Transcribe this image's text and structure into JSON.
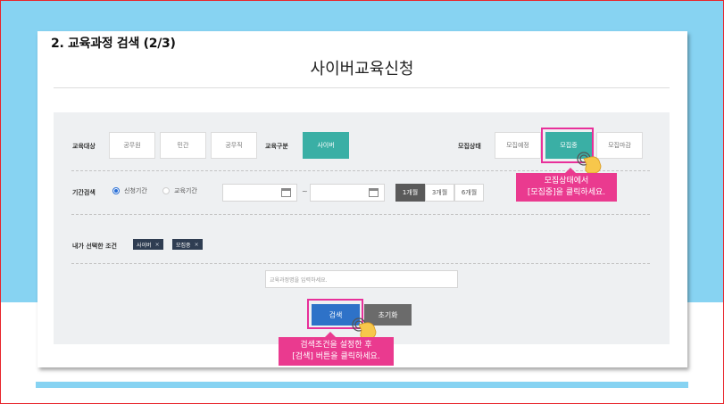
{
  "step_title": "2. 교육과정 검색 (2/3)",
  "page_title": "사이버교육신청",
  "filters": {
    "target_label": "교육대상",
    "target_options": [
      "공무원",
      "민간",
      "공무직"
    ],
    "type_label": "교육구분",
    "type_selected": "사이버",
    "status_label": "모집상태",
    "status_options": [
      "모집예정",
      "모집중",
      "모집마감"
    ],
    "status_selected": "모집중"
  },
  "period": {
    "label": "기간검색",
    "radio_apply": "신청기간",
    "radio_edu": "교육기간",
    "radio_selected": "신청기간",
    "tilde": "~",
    "ranges": [
      "1개월",
      "3개월",
      "6개월"
    ],
    "range_selected": "1개월"
  },
  "selected_conditions": {
    "label": "내가 선택한 조건",
    "chips": [
      "사이버",
      "모집중"
    ],
    "remove_glyph": "×"
  },
  "search": {
    "placeholder": "교육과정명을 입력하세요.",
    "search_label": "검색",
    "reset_label": "초기화"
  },
  "callouts": {
    "status_line1": "모집상태에서",
    "status_line2": "[모집중]을 클릭하세요.",
    "search_line1": "검색조건을 설정한 후",
    "search_line2": "[검색] 버튼을 클릭하세요."
  },
  "colors": {
    "teal": "#3aafa5",
    "blue": "#2e72c8",
    "pink": "#ea3a8f",
    "sky": "#87d3f2",
    "chip": "#2f3d52"
  }
}
